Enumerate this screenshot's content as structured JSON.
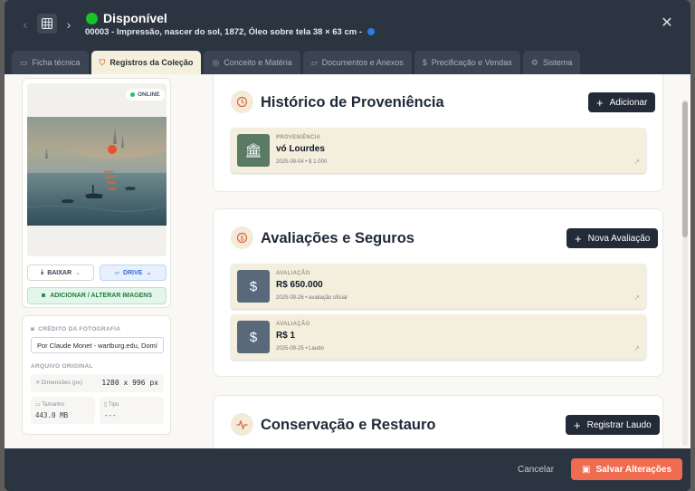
{
  "header": {
    "status": "Disponível",
    "subtitle": "00003 - Impressão, nascer do sol, 1872, Óleo sobre tela 38 × 63 cm -"
  },
  "tabs": [
    {
      "label": "Ficha técnica",
      "icon": "clipboard-icon",
      "active": false
    },
    {
      "label": "Registros da Coleção",
      "icon": "shield-icon",
      "active": true
    },
    {
      "label": "Conceito e Matéria",
      "icon": "palette-icon",
      "active": false
    },
    {
      "label": "Documentos e Anexos",
      "icon": "folder-icon",
      "active": false
    },
    {
      "label": "Precificação e Vendas",
      "icon": "dollar-icon",
      "active": false
    },
    {
      "label": "Sistema",
      "icon": "gear-icon",
      "active": false
    }
  ],
  "image_panel": {
    "badge": "ONLINE",
    "download_label": "BAIXAR",
    "drive_label": "DRIVE",
    "add_images_label": "ADICIONAR / ALTERAR IMAGENS"
  },
  "metadata": {
    "credit_label": "CRÉDITO DA FOTOGRAFIA",
    "credit_value": "Por Claude Monet - wartburg.edu, Domín",
    "original_label": "ARQUIVO ORIGINAL",
    "dimensions_label": "Dimensões (px)",
    "dimensions_value": "1280 x 996 px",
    "size_label": "Tamanho",
    "size_value": "443.0 MB",
    "type_label": "Tipo",
    "type_value": "---"
  },
  "provenance": {
    "title": "Histórico de Proveniência",
    "button": "Adicionar",
    "entries": [
      {
        "type": "PROVENIÊNCIA",
        "name": "vó Lourdes",
        "detail": "2025-09-04 • $ 1.000"
      }
    ]
  },
  "appraisals": {
    "title": "Avaliações e Seguros",
    "button": "Nova Avaliação",
    "entries": [
      {
        "type": "AVALIAÇÃO",
        "name": "R$ 650.000",
        "detail": "2025-09-26 • avaliação oficial"
      },
      {
        "type": "AVALIAÇÃO",
        "name": "R$ 1",
        "detail": "2025-09-25 • Laudo"
      }
    ]
  },
  "conservation": {
    "title": "Conservação e Restauro",
    "button": "Registrar Laudo"
  },
  "footer": {
    "cancel": "Cancelar",
    "save": "Salvar Alterações"
  },
  "colors": {
    "accent": "#ef6c50",
    "status_green": "#19c12b",
    "dark": "#222b37"
  }
}
